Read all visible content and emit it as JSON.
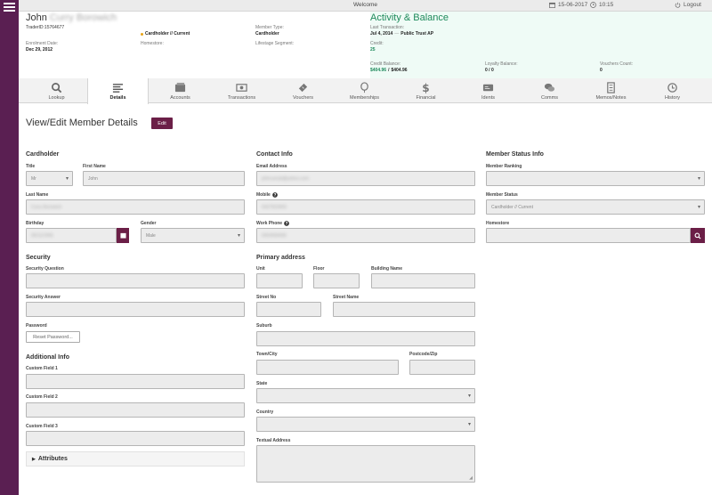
{
  "topbar": {
    "title": "Welcome",
    "date": "15-06-2017",
    "time": "10:15",
    "logout": "Logout"
  },
  "member": {
    "first_name": "John",
    "surname": "Curry Borowich",
    "trader_id": "TraderID:15764677",
    "status": "Cardholder // Current",
    "enrolment_label": "Enrolment Date:",
    "enrolment_date": "Dec 29, 2012",
    "homestore_label": "Homestore:",
    "member_type_label": "Member Type:",
    "member_type": "Cardholder",
    "lifestage_label": "Lifestage Segment:"
  },
  "activity": {
    "title": "Activity & Balance",
    "last_tx_label": "Last Transaction:",
    "last_tx_date": "Jul 4, 2014",
    "last_tx_sep": "—",
    "last_tx_store": "Public Trust AP",
    "credit_label": "Credit:",
    "credit_value": "25",
    "credit_balance_label": "Credit Balance:",
    "credit_balance_a": "$404.96",
    "credit_balance_sep": "/",
    "credit_balance_b": "$404.96",
    "loyalty_label": "Loyalty Balance:",
    "loyalty_value": "0 / 0",
    "vouchers_label": "Vouchers Count:",
    "vouchers_value": "0"
  },
  "nav": {
    "tabs": [
      {
        "label": "Lookup",
        "icon": "search-icon"
      },
      {
        "label": "Details",
        "icon": "list-icon"
      },
      {
        "label": "Accounts",
        "icon": "wallet-icon"
      },
      {
        "label": "Transactions",
        "icon": "cash-icon"
      },
      {
        "label": "Vouchers",
        "icon": "ticket-icon"
      },
      {
        "label": "Memberships",
        "icon": "balloon-icon"
      },
      {
        "label": "Financial",
        "icon": "dollar-icon"
      },
      {
        "label": "Idents",
        "icon": "card-icon"
      },
      {
        "label": "Comms",
        "icon": "chat-icon"
      },
      {
        "label": "Memos/Notes",
        "icon": "note-icon"
      },
      {
        "label": "History",
        "icon": "history-icon"
      }
    ],
    "active": "Details"
  },
  "main": {
    "title": "View/Edit Member Details",
    "edit_label": "Edit"
  },
  "cardholder": {
    "heading": "Cardholder",
    "title_label": "Title",
    "title_value": "Mr",
    "first_name_label": "First Name",
    "first_name_value": "John",
    "last_name_label": "Last Name",
    "last_name_value": "Curry Borowich",
    "birthday_label": "Birthday",
    "birthday_value": "06/11/1956",
    "gender_label": "Gender",
    "gender_value": "Male"
  },
  "security": {
    "heading": "Security",
    "question_label": "Security Question",
    "answer_label": "Security Answer",
    "password_label": "Password",
    "reset_label": "Reset Password..."
  },
  "additional": {
    "heading": "Additional Info",
    "cf1_label": "Custom Field 1",
    "cf2_label": "Custom Field 2",
    "cf3_label": "Custom Field 3",
    "attributes_label": "Attributes"
  },
  "contact": {
    "heading": "Contact Info",
    "email_label": "Email Address",
    "email_value": "johncurryb@yahoo.com",
    "mobile_label": "Mobile",
    "mobile_value": "0437923903",
    "work_label": "Work Phone",
    "work_value": "0404566666"
  },
  "address": {
    "heading": "Primary address",
    "unit_label": "Unit",
    "floor_label": "Floor",
    "building_label": "Building Name",
    "street_no_label": "Street No",
    "street_name_label": "Street Name",
    "suburb_label": "Suburb",
    "town_label": "Town/City",
    "postcode_label": "Postcode/Zip",
    "state_label": "State",
    "country_label": "Country",
    "textual_label": "Textual Address"
  },
  "status_info": {
    "heading": "Member Status Info",
    "ranking_label": "Member Ranking",
    "status_label": "Member Status",
    "status_value": "Cardholder // Current",
    "homestore_label": "Homestore"
  },
  "colors": {
    "sidebar": "#5a1f52",
    "accent_button": "#6b1f47",
    "activity_bg": "#effbf6",
    "activity_title": "#1e8a5b",
    "status_dot": "#e8a317"
  }
}
